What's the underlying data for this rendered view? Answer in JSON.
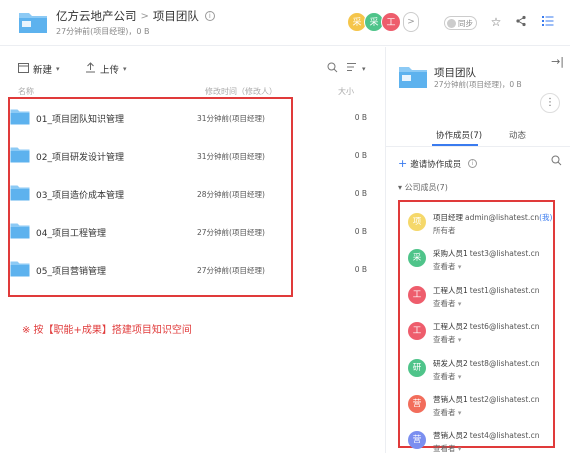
{
  "header": {
    "breadcrumb_root": "亿方云地产公司",
    "breadcrumb_sep": ">",
    "breadcrumb_current": "项目团队",
    "subtitle": "27分钟前(项目经理)，0 B",
    "avatars": [
      {
        "char": "采",
        "color": "#f5c54a"
      },
      {
        "char": "采",
        "color": "#4fc48a"
      },
      {
        "char": "工",
        "color": "#ee5d6c"
      }
    ],
    "more_avatars": ">",
    "sync_label": "同步"
  },
  "toolbar": {
    "new_label": "新建",
    "upload_label": "上传"
  },
  "columns": {
    "name": "名称",
    "modified": "修改时间（修改人）",
    "size": "大小"
  },
  "files": [
    {
      "name": "01_项目团队知识管理",
      "time": "31分钟前(项目经理)",
      "size": "0 B"
    },
    {
      "name": "02_项目研发设计管理",
      "time": "31分钟前(项目经理)",
      "size": "0 B"
    },
    {
      "name": "03_项目造价成本管理",
      "time": "28分钟前(项目经理)",
      "size": "0 B"
    },
    {
      "name": "04_项目工程管理",
      "time": "27分钟前(项目经理)",
      "size": "0 B"
    },
    {
      "name": "05_项目营销管理",
      "time": "27分钟前(项目经理)",
      "size": "0 B"
    }
  ],
  "note": "※ 按【职能+成果】搭建项目知识空间",
  "panel": {
    "title": "项目团队",
    "subtitle": "27分钟前(项目经理)，0 B",
    "tab_members": "协作成员(7)",
    "tab_activity": "动态",
    "invite_label": "邀请协作成员",
    "group_label": "公司成员(7)",
    "members": [
      {
        "avatar": "项",
        "color": "#f5d86a",
        "name": "项目经理",
        "email": "admin@lishatest.cn",
        "me": "(我)",
        "role": "所有者"
      },
      {
        "avatar": "采",
        "color": "#4fc48a",
        "name": "采购人员1",
        "email": "test3@lishatest.cn",
        "me": "",
        "role": "查看者"
      },
      {
        "avatar": "工",
        "color": "#ee5d6c",
        "name": "工程人员1",
        "email": "test1@lishatest.cn",
        "me": "",
        "role": "查看者"
      },
      {
        "avatar": "工",
        "color": "#ee5d6c",
        "name": "工程人员2",
        "email": "test6@lishatest.cn",
        "me": "",
        "role": "查看者"
      },
      {
        "avatar": "研",
        "color": "#4fc48a",
        "name": "研发人员2",
        "email": "test8@lishatest.cn",
        "me": "",
        "role": "查看者"
      },
      {
        "avatar": "营",
        "color": "#f26d5b",
        "name": "营销人员1",
        "email": "test2@lishatest.cn",
        "me": "",
        "role": "查看者"
      },
      {
        "avatar": "营",
        "color": "#7b8ff0",
        "name": "营销人员2",
        "email": "test4@lishatest.cn",
        "me": "",
        "role": "查看者"
      }
    ]
  },
  "colors": {
    "accent": "#3a7bef",
    "highlight_border": "#e03a3a",
    "folder": "#6cb7f0"
  }
}
